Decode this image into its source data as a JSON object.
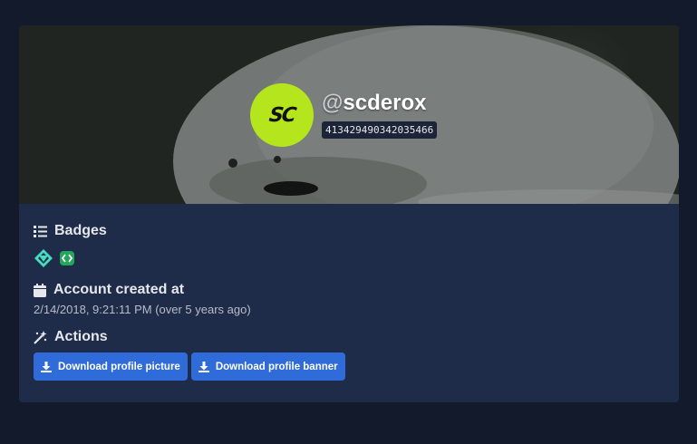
{
  "profile": {
    "handle_prefix": "@",
    "username": "scderox",
    "user_id": "413429490342035466",
    "avatar_text": "SC",
    "colors": {
      "avatar_bg": "#b5e61d",
      "card_bg": "#1f2c49",
      "page_bg": "#121a2c",
      "button_bg": "#2f6bd9"
    }
  },
  "badges": {
    "title": "Badges",
    "icon": "list-icon",
    "items": [
      {
        "icon": "hypesquad-balance-icon",
        "color": "#45ddc0"
      },
      {
        "icon": "active-developer-icon",
        "color": "#23a55a"
      }
    ]
  },
  "account": {
    "title": "Account created at",
    "icon": "calendar-icon",
    "created_text": "2/14/2018, 9:21:11 PM (over 5 years ago)"
  },
  "actions": {
    "title": "Actions",
    "icon": "magic-wand-icon",
    "buttons": [
      {
        "label": "Download profile picture",
        "icon": "download-icon"
      },
      {
        "label": "Download profile banner",
        "icon": "download-icon"
      }
    ]
  }
}
